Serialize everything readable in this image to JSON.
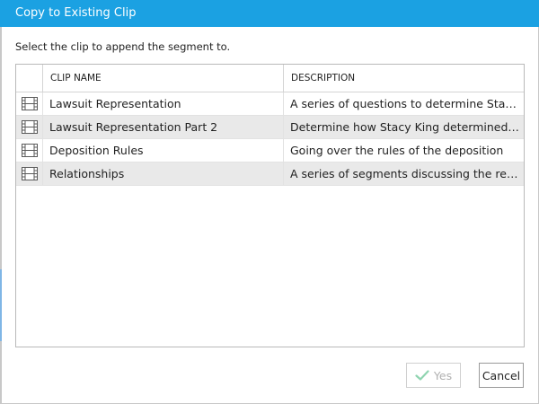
{
  "dialog": {
    "title": "Copy to Existing Clip",
    "instruction": "Select the clip to append the segment to."
  },
  "grid": {
    "columns": {
      "name": "CLIP NAME",
      "description": "DESCRIPTION"
    },
    "rows": [
      {
        "icon": "film-icon",
        "name": "Lawsuit Representation",
        "description": "A series of questions to determine Stacy..."
      },
      {
        "icon": "film-icon",
        "name": "Lawsuit Representation Part 2",
        "description": "Determine how Stacy King determined t..."
      },
      {
        "icon": "film-icon",
        "name": "Deposition Rules",
        "description": "Going over the rules of the deposition"
      },
      {
        "icon": "film-icon",
        "name": "Relationships",
        "description": "A series of segments discussing the relati..."
      }
    ]
  },
  "buttons": {
    "yes_label": "Yes",
    "yes_icon": "check-icon",
    "yes_enabled": false,
    "cancel_label": "Cancel"
  },
  "colors": {
    "title_bar": "#1ba1e2",
    "title_text": "#ffffff",
    "row_alt": "#e9e9e9",
    "disabled_check": "#8fd4b0"
  }
}
